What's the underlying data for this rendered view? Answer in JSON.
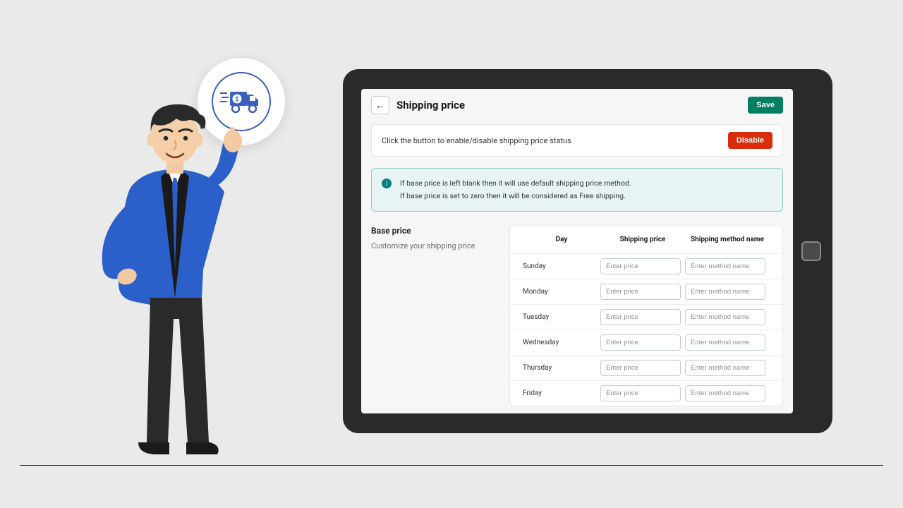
{
  "page": {
    "title": "Shipping price",
    "save_label": "Save"
  },
  "status": {
    "text": "Click the button to enable/disable shipping price status",
    "button_label": "Disable"
  },
  "info": {
    "line1": "If base price is left blank then it will use default shipping price method.",
    "line2": "If base price is set to zero then it will be considered as Free shipping."
  },
  "side": {
    "title": "Base price",
    "subtitle": "Customize your shipping price"
  },
  "table": {
    "headers": {
      "day": "Day",
      "price": "Shipping price",
      "method": "Shipping method name"
    },
    "placeholders": {
      "price": "Enter price",
      "method": "Enter method name"
    },
    "days": [
      "Sunday",
      "Monday",
      "Tuesday",
      "Wednesday",
      "Thursday",
      "Friday"
    ]
  },
  "colors": {
    "save_bg": "#008060",
    "disable_bg": "#d82c0d",
    "accent_blue": "#3a5fbf"
  }
}
